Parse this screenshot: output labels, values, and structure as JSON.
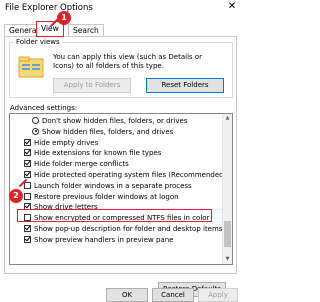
{
  "window": {
    "title": "File Explorer Options",
    "close_glyph": "✕"
  },
  "tabs": [
    {
      "label": "General",
      "selected": false
    },
    {
      "label": "View",
      "selected": true
    },
    {
      "label": "Search",
      "selected": false
    }
  ],
  "folder_views": {
    "legend": "Folder views",
    "description": "You can apply this view (such as Details or Icons) to all folders of this type.",
    "apply_button": "Apply to Folders",
    "reset_button": "Reset Folders",
    "icon": "folder-views-icon"
  },
  "advanced": {
    "label": "Advanced settings:",
    "items": [
      {
        "type": "radio",
        "checked": false,
        "label": "Don't show hidden files, folders, or drives"
      },
      {
        "type": "radio",
        "checked": true,
        "label": "Show hidden files, folders, and drives"
      },
      {
        "type": "check",
        "checked": true,
        "label": "Hide empty drives"
      },
      {
        "type": "check",
        "checked": true,
        "label": "Hide extensions for known file types"
      },
      {
        "type": "check",
        "checked": true,
        "label": "Hide folder merge conflicts"
      },
      {
        "type": "check",
        "checked": true,
        "label": "Hide protected operating system files (Recommended)"
      },
      {
        "type": "check",
        "checked": false,
        "label": "Launch folder windows in a separate process"
      },
      {
        "type": "check",
        "checked": false,
        "label": "Restore previous folder windows at logon"
      },
      {
        "type": "check",
        "checked": true,
        "label": "Show drive letters"
      },
      {
        "type": "check",
        "checked": false,
        "label": "Show encrypted or compressed NTFS files in color"
      },
      {
        "type": "check",
        "checked": true,
        "label": "Show pop-up description for folder and desktop items"
      },
      {
        "type": "check",
        "checked": true,
        "label": "Show preview handlers in preview pane"
      }
    ],
    "restore_defaults": "Restore Defaults"
  },
  "footer": {
    "ok": "OK",
    "cancel": "Cancel",
    "apply": "Apply"
  },
  "annotations": {
    "marker_1": "1",
    "marker_2": "2",
    "accent_color": "#e0232b"
  }
}
